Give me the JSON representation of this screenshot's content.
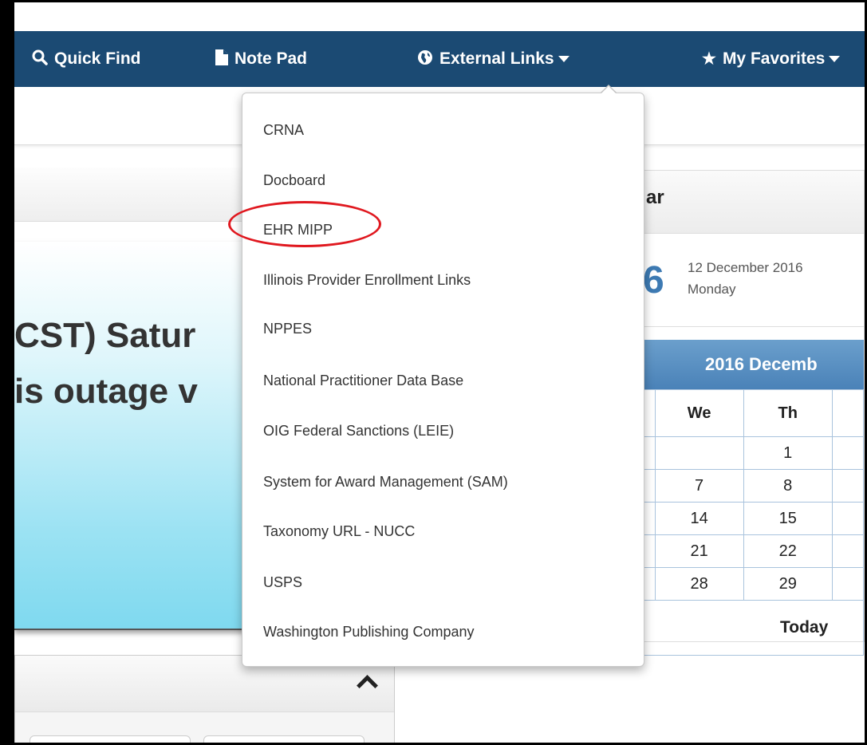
{
  "nav": {
    "items": [
      {
        "label": "Quick Find",
        "icon": "search-icon"
      },
      {
        "label": "Note Pad",
        "icon": "document-icon"
      },
      {
        "label": "External Links",
        "icon": "globe-icon",
        "has_caret": true
      },
      {
        "label": "My Favorites",
        "icon": "star-icon",
        "has_caret": true
      }
    ],
    "color": "#1b4a73"
  },
  "alert": {
    "line1": "CST) Satur",
    "line2": "is outage v"
  },
  "dropdown": {
    "items": [
      "CRNA",
      "Docboard",
      "EHR MIPP",
      "Illinois Provider Enrollment Links",
      "NPPES",
      "National Practitioner Data Base",
      "OIG Federal Sanctions (LEIE)",
      "System for Award Management (SAM)",
      "Taxonomy URL - NUCC",
      "USPS",
      "Washington Publishing Company"
    ],
    "highlighted": "EHR MIPP",
    "highlight_color": "#e0181f"
  },
  "calendar": {
    "title_fragment": "ar",
    "big_digit_fragment": "6",
    "date_text": "12 December 2016",
    "weekday_text": "Monday",
    "month_bar": "2016 Decemb",
    "headers": [
      "We",
      "Th"
    ],
    "rows": [
      [
        "",
        "1"
      ],
      [
        "7",
        "8"
      ],
      [
        "14",
        "15"
      ],
      [
        "21",
        "22"
      ],
      [
        "28",
        "29"
      ]
    ],
    "today_label": "Today"
  }
}
